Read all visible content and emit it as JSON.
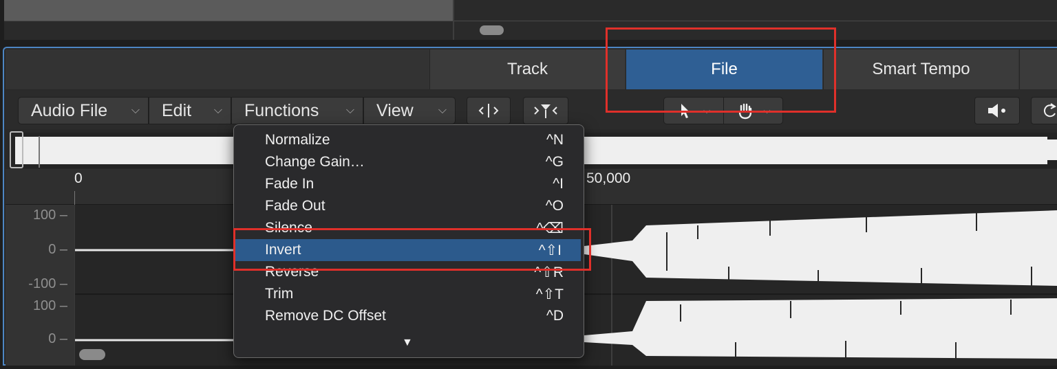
{
  "tabs": [
    {
      "label": "Track",
      "selected": false
    },
    {
      "label": "File",
      "selected": true
    },
    {
      "label": "Smart Tempo",
      "selected": false
    }
  ],
  "menubar": {
    "audio_file": "Audio File",
    "edit": "Edit",
    "functions": "Functions",
    "view": "View"
  },
  "toolbar": {
    "split_icon": "split-icon",
    "strip_silence_icon": "strip-silence-icon",
    "pointer_tool_icon": "pointer-icon",
    "hand_tool_icon": "hand-icon",
    "speaker_icon": "speaker-icon",
    "cycle_icon": "cycle-icon"
  },
  "ruler": {
    "start_label": "0",
    "mid_label": "50,000"
  },
  "amplitude_axis": {
    "upper": [
      "100",
      "0",
      "-100"
    ],
    "lower": [
      "100",
      "0"
    ]
  },
  "functions_menu": {
    "items": [
      {
        "label": "Normalize",
        "shortcut": "^N",
        "highlighted": false
      },
      {
        "label": "Change Gain…",
        "shortcut": "^G",
        "highlighted": false
      },
      {
        "label": "Fade In",
        "shortcut": "^I",
        "highlighted": false
      },
      {
        "label": "Fade Out",
        "shortcut": "^O",
        "highlighted": false
      },
      {
        "label": "Silence",
        "shortcut": "^⌫",
        "highlighted": false
      },
      {
        "label": "Invert",
        "shortcut": "^⇧I",
        "highlighted": true
      },
      {
        "label": "Reverse",
        "shortcut": "^⇧R",
        "highlighted": false
      },
      {
        "label": "Trim",
        "shortcut": "^⇧T",
        "highlighted": false
      },
      {
        "label": "Remove DC Offset",
        "shortcut": "^D",
        "highlighted": false
      }
    ],
    "more_arrow": "▼"
  },
  "colors": {
    "selected_tab": "#2f5f94",
    "highlight": "#2c5a8c",
    "annotation_red": "#e0302a",
    "frame_blue": "#4d86c4"
  }
}
